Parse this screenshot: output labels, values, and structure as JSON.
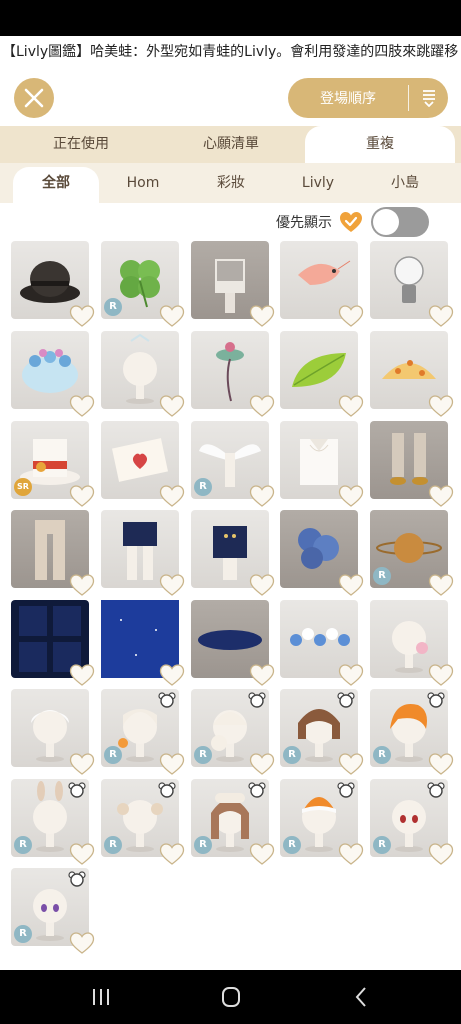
{
  "ticker_text": "【Livly圖鑑】哈美蛙：外型宛如青蛙的Livly。會利用發達的四肢來跳躍移",
  "header": {
    "close_icon": "close-x-icon",
    "sort_label": "登場順序",
    "sort_icon": "sort-list-icon"
  },
  "tabs_primary": [
    {
      "label": "正在使用",
      "active": false
    },
    {
      "label": "心願清單",
      "active": false
    },
    {
      "label": "重複",
      "active": true
    }
  ],
  "tabs_secondary": [
    {
      "label": "全部",
      "active": true
    },
    {
      "label": "Hom",
      "active": false
    },
    {
      "label": "彩妝",
      "active": false
    },
    {
      "label": "Livly",
      "active": false
    },
    {
      "label": "小島",
      "active": false
    }
  ],
  "priority": {
    "label": "優先顯示",
    "toggle_on": false
  },
  "items": [
    {
      "name": "black-bowler-hat",
      "badge": "",
      "bear": false,
      "dark": false
    },
    {
      "name": "four-leaf-clover",
      "badge": "R",
      "bear": false,
      "dark": false
    },
    {
      "name": "plaid-shirt",
      "badge": "",
      "bear": false,
      "dark": true
    },
    {
      "name": "shrimp",
      "badge": "",
      "bear": false,
      "dark": false
    },
    {
      "name": "glass-bulb-lamp",
      "badge": "",
      "bear": false,
      "dark": false
    },
    {
      "name": "blue-flower-crown",
      "badge": "",
      "bear": false,
      "dark": false
    },
    {
      "name": "sparkle-hair",
      "badge": "",
      "bear": false,
      "dark": false
    },
    {
      "name": "rose-stem",
      "badge": "",
      "bear": false,
      "dark": false
    },
    {
      "name": "green-leaf",
      "badge": "",
      "bear": false,
      "dark": false
    },
    {
      "name": "leopard-hair-clip",
      "badge": "",
      "bear": false,
      "dark": false
    },
    {
      "name": "mad-hatter-top-hat",
      "badge": "SR",
      "bear": false,
      "dark": false
    },
    {
      "name": "love-letter",
      "badge": "",
      "bear": false,
      "dark": false
    },
    {
      "name": "angel-wings",
      "badge": "R",
      "bear": false,
      "dark": false
    },
    {
      "name": "white-ribbon-blouse",
      "badge": "",
      "bear": false,
      "dark": false
    },
    {
      "name": "brown-boots",
      "badge": "",
      "bear": false,
      "dark": true
    },
    {
      "name": "beige-tights",
      "badge": "",
      "bear": false,
      "dark": true
    },
    {
      "name": "navy-shorts",
      "badge": "",
      "bear": false,
      "dark": false
    },
    {
      "name": "navy-band-jacket",
      "badge": "",
      "bear": false,
      "dark": false
    },
    {
      "name": "blue-hydrangea",
      "badge": "",
      "bear": false,
      "dark": true
    },
    {
      "name": "planet-saturn",
      "badge": "R",
      "bear": false,
      "dark": true
    },
    {
      "name": "starry-wallpaper",
      "badge": "",
      "bear": false,
      "dark": false,
      "navy": true
    },
    {
      "name": "starry-floor",
      "badge": "",
      "bear": false,
      "dark": false,
      "navy": true
    },
    {
      "name": "starry-rug",
      "badge": "",
      "bear": false,
      "dark": true
    },
    {
      "name": "blue-flower-garland",
      "badge": "",
      "bear": false,
      "dark": false
    },
    {
      "name": "bubblegum-face",
      "badge": "",
      "bear": false,
      "dark": false
    },
    {
      "name": "white-curly-wig",
      "badge": "",
      "bear": false,
      "dark": false
    },
    {
      "name": "orange-bow-wig",
      "badge": "R",
      "bear": true,
      "dark": false
    },
    {
      "name": "fluffy-ponytail-wig",
      "badge": "R",
      "bear": true,
      "dark": false
    },
    {
      "name": "brown-bob-wig",
      "badge": "R",
      "bear": true,
      "dark": false
    },
    {
      "name": "orange-short-wig",
      "badge": "R",
      "bear": true,
      "dark": false
    },
    {
      "name": "bunny-ear-buns",
      "badge": "R",
      "bear": true,
      "dark": false
    },
    {
      "name": "sheep-horn-wig",
      "badge": "R",
      "bear": true,
      "dark": false
    },
    {
      "name": "cream-long-wig",
      "badge": "R",
      "bear": true,
      "dark": false
    },
    {
      "name": "orange-beanie-wig",
      "badge": "R",
      "bear": true,
      "dark": false
    },
    {
      "name": "red-eyes-face",
      "badge": "R",
      "bear": true,
      "dark": false
    },
    {
      "name": "purple-eyes-face",
      "badge": "R",
      "bear": true,
      "dark": false
    }
  ],
  "colors": {
    "accent_gold": "#d8b777",
    "heart_orange": "#f0a23a",
    "tab_bar": "#efe4cd"
  },
  "nav": {
    "recents_icon": "recents-icon",
    "home_icon": "home-icon",
    "back_icon": "back-icon"
  }
}
